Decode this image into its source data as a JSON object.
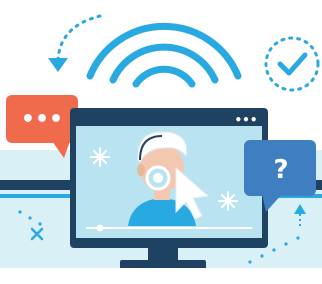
{
  "illustration": {
    "speech_bubble_left": {
      "dots": "•••",
      "color": "#ef6b4c"
    },
    "speech_bubble_right": {
      "symbol": "?",
      "color": "#3f7fc1"
    },
    "monitor": {
      "frame_color": "#1f4263",
      "screen_color": "#b9e3f1",
      "window_dots": "•••"
    },
    "colors": {
      "accent_blue": "#29a9e1",
      "light_teal": "#d8f0f6",
      "dark_navy": "#1f4263",
      "skin": "#f2c9b0",
      "cursor": "#ffffff"
    },
    "icons": [
      "wifi-icon",
      "check-circle-icon",
      "refresh-arrow-icon",
      "cursor-icon",
      "question-icon",
      "chat-icon"
    ]
  }
}
